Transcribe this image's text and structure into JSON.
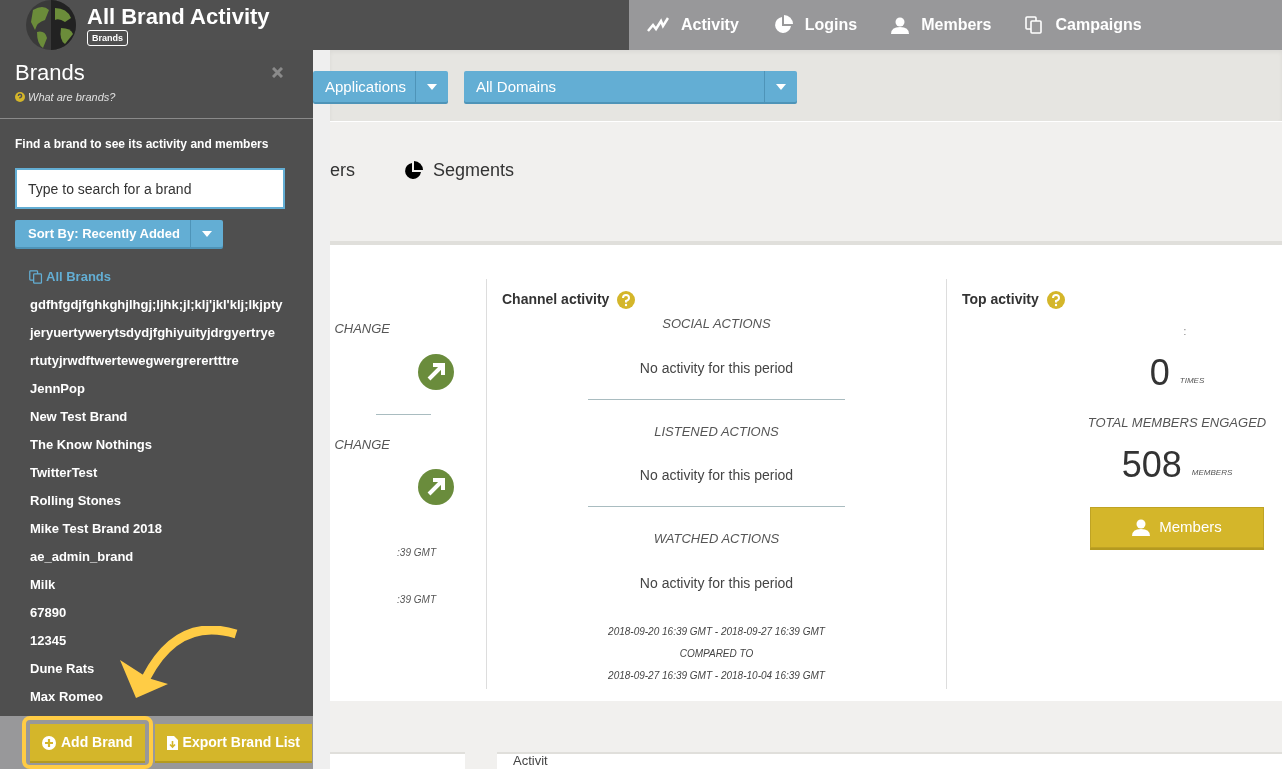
{
  "header": {
    "title": "All Brand Activity",
    "badge": "Brands",
    "nav": [
      {
        "label": "Activity",
        "kind": "activity"
      },
      {
        "label": "Logins",
        "kind": "logins"
      },
      {
        "label": "Members",
        "kind": "members"
      },
      {
        "label": "Campaigns",
        "kind": "campaigns"
      }
    ]
  },
  "filters": [
    {
      "label": "Applications"
    },
    {
      "label": "All Domains"
    }
  ],
  "tabs": [
    {
      "label": "ers",
      "kind": "plain"
    },
    {
      "label": "Segments",
      "kind": "segments"
    }
  ],
  "summary": {
    "left": {
      "rows": [
        {
          "label": "CHANGE"
        },
        {
          "label": "CHANGE"
        }
      ],
      "dates": [
        ":39 GMT",
        ":39 GMT"
      ]
    },
    "channel": {
      "title": "Channel activity",
      "sections": [
        {
          "heading": "SOCIAL ACTIONS",
          "message": "No activity for this period"
        },
        {
          "heading": "LISTENED ACTIONS",
          "message": "No activity for this period"
        },
        {
          "heading": "WATCHED ACTIONS",
          "message": "No activity for this period"
        }
      ],
      "period": [
        "2018-09-20 16:39 GMT - 2018-09-27 16:39 GMT",
        "COMPARED TO",
        "2018-09-27 16:39 GMT - 2018-10-04 16:39 GMT"
      ]
    },
    "top": {
      "title": "Top activity",
      "mark": ":",
      "count": "0",
      "count_unit": "TIMES",
      "total_label": "TOTAL MEMBERS ENGAGED",
      "total": "508",
      "total_unit": "MEMBERS",
      "button": "Members"
    }
  },
  "bottom_cards": [
    {
      "kind": "blank"
    },
    {
      "kind": "titled",
      "title": "Activit"
    }
  ],
  "sidebar": {
    "title": "Brands",
    "help": "What are brands?",
    "prompt": "Find a brand to see its activity and members",
    "search": {
      "placeholder": "Type to search for a brand"
    },
    "sort": "Sort By: Recently Added",
    "brands": [
      {
        "label": "All Brands",
        "selected": true
      },
      {
        "label": "gdfhfgdjfghkghjlhgj;ljhk;jl;klj'jkl'klj;lkjpty",
        "selected": false
      },
      {
        "label": "jeryuertywerytsdydjfghiyuityjdrgyertrye",
        "selected": false
      },
      {
        "label": "rtutyjrwdftwertewegwergrerertttre",
        "selected": false
      },
      {
        "label": "JennPop",
        "selected": false
      },
      {
        "label": "New Test Brand",
        "selected": false
      },
      {
        "label": "The Know Nothings",
        "selected": false
      },
      {
        "label": "TwitterTest",
        "selected": false
      },
      {
        "label": "Rolling Stones",
        "selected": false
      },
      {
        "label": "Mike Test Brand 2018",
        "selected": false
      },
      {
        "label": "ae_admin_brand",
        "selected": false
      },
      {
        "label": "Milk",
        "selected": false
      },
      {
        "label": "67890",
        "selected": false
      },
      {
        "label": "12345",
        "selected": false
      },
      {
        "label": "Dune Rats",
        "selected": false
      },
      {
        "label": "Max Romeo",
        "selected": false
      }
    ],
    "actions": [
      {
        "label": "Add Brand",
        "kind": "add",
        "highlighted": true
      },
      {
        "label": "Export Brand List",
        "kind": "export",
        "highlighted": false
      }
    ]
  }
}
